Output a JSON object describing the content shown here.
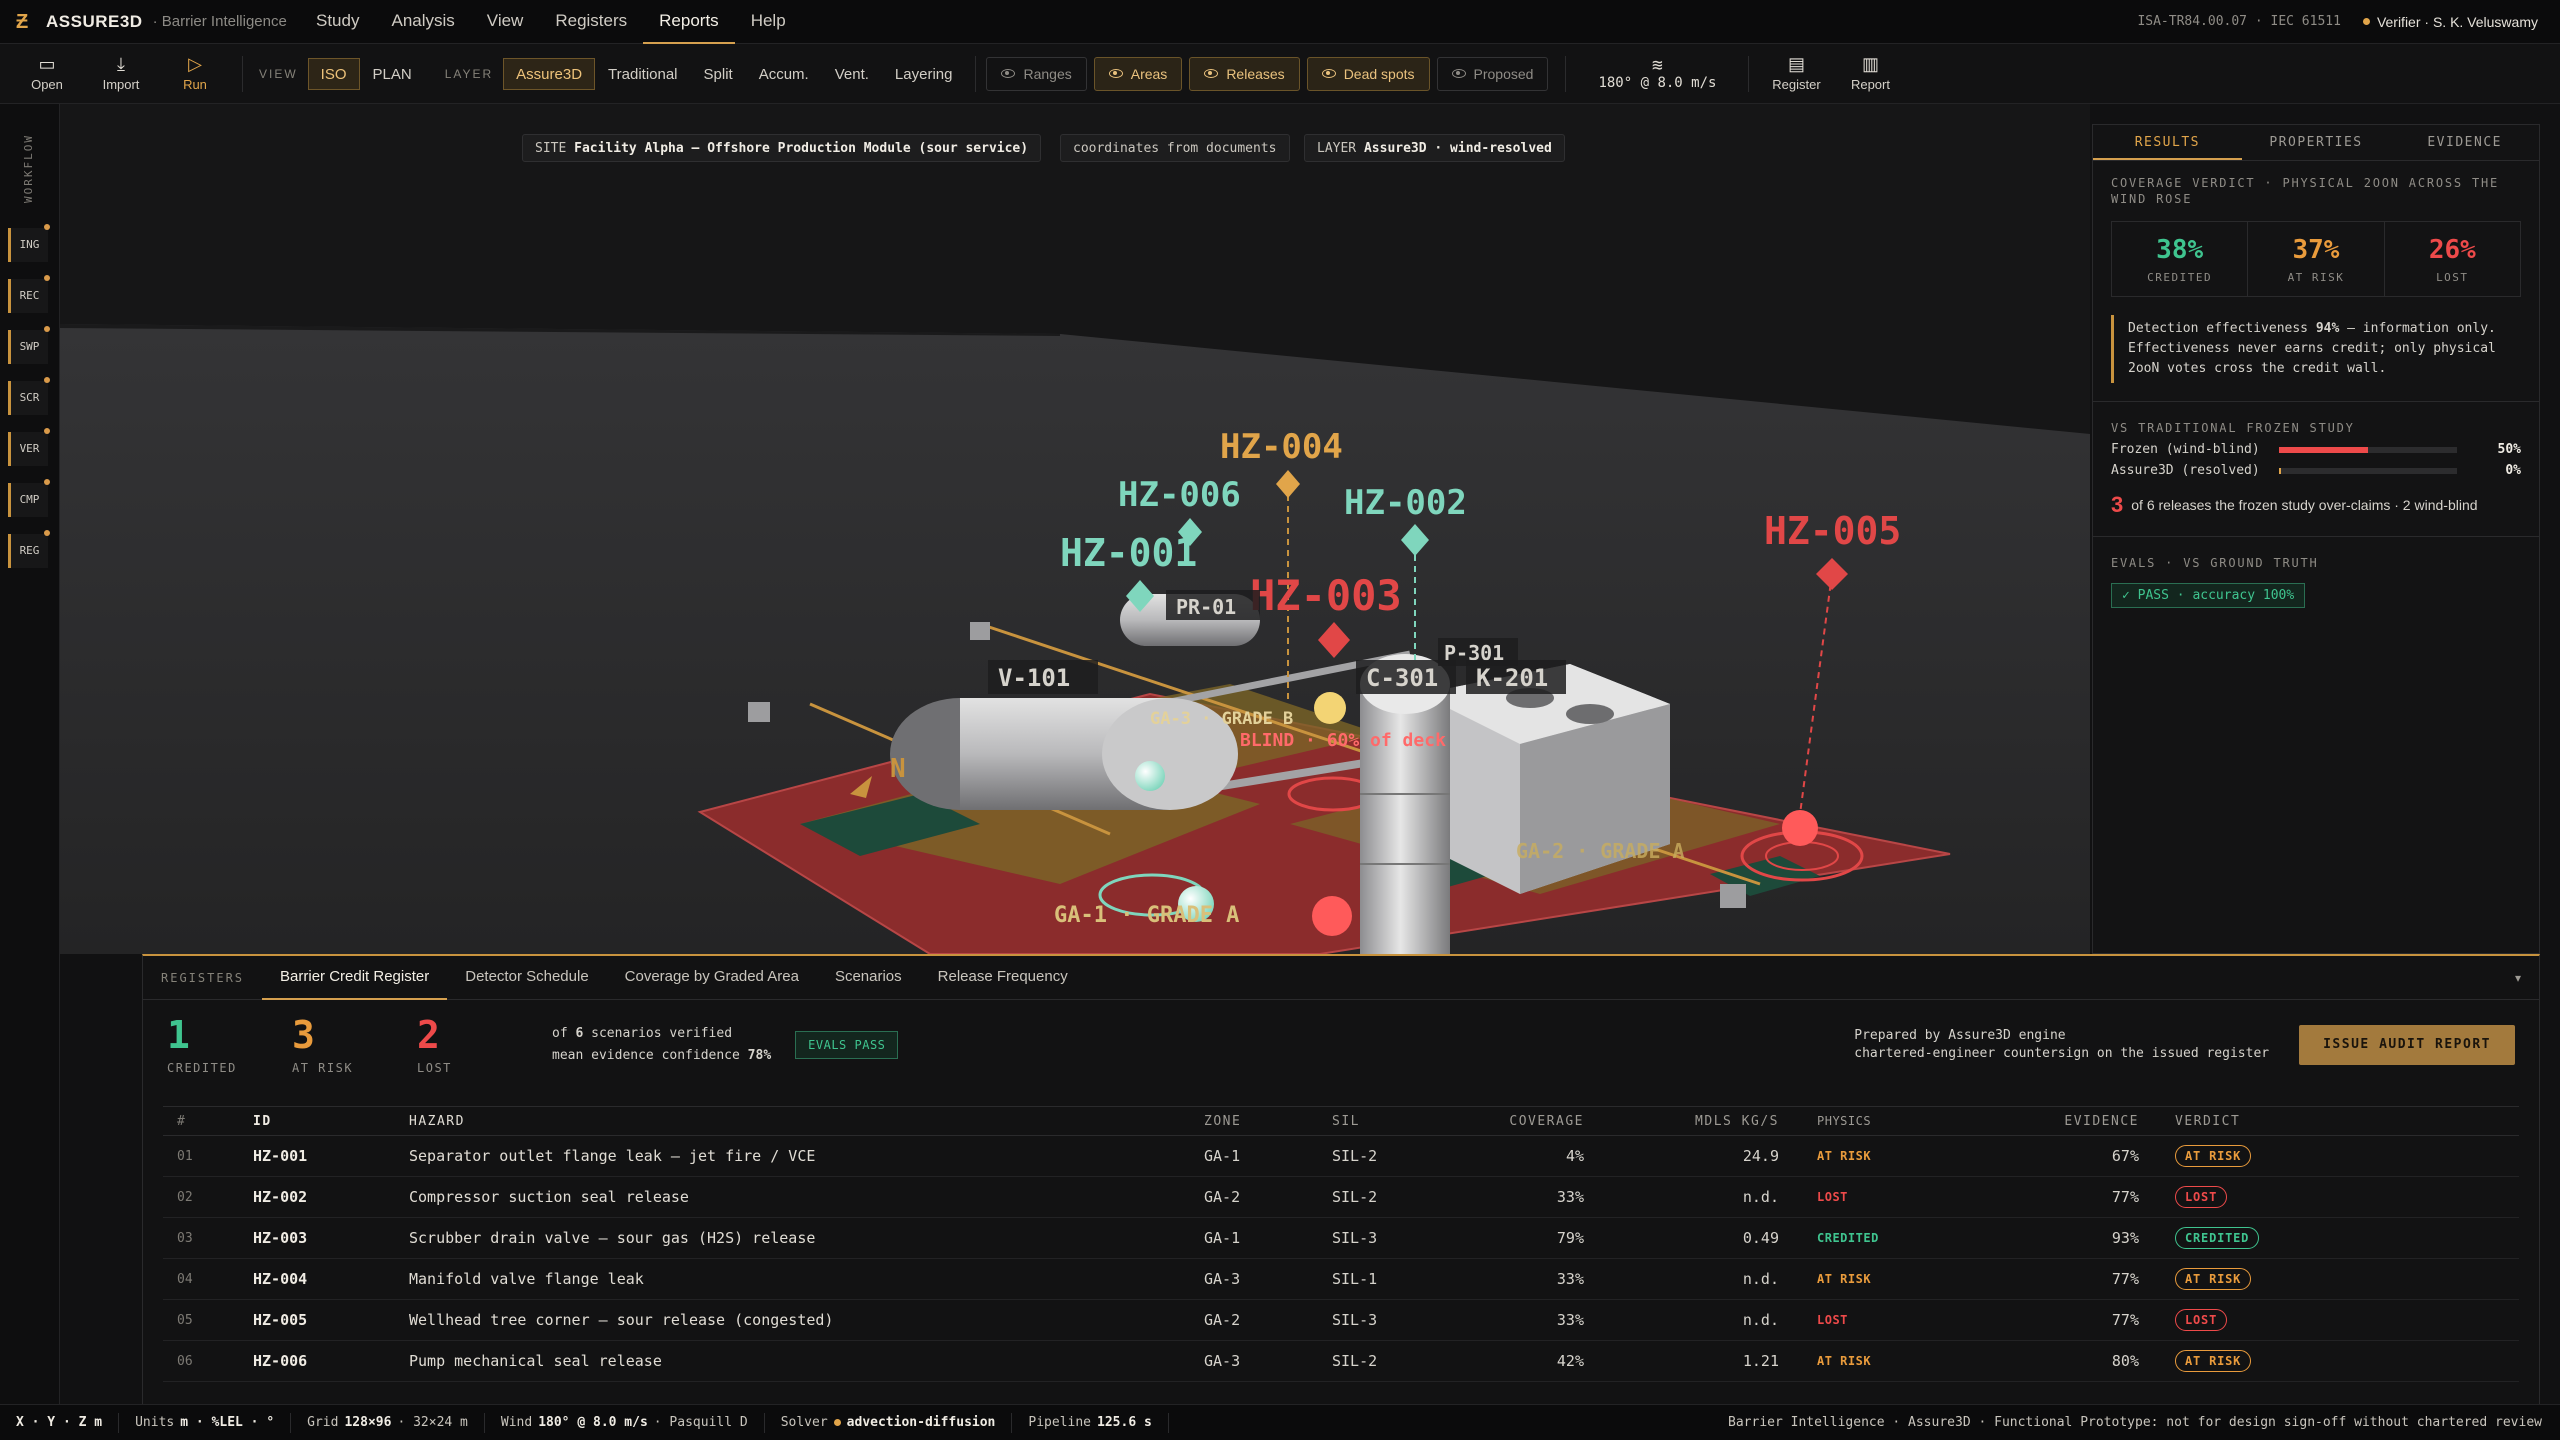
{
  "brand": {
    "name": "ASSURE3D",
    "sub": "· Barrier Intelligence"
  },
  "menu": [
    "Study",
    "Analysis",
    "View",
    "Registers",
    "Reports",
    "Help"
  ],
  "menu_active": "Reports",
  "std_ref": "ISA-TR84.00.07 · IEC 61511",
  "verifier": "Verifier · S. K. Veluswamy",
  "toolbar": {
    "file": [
      {
        "icon": "▭",
        "label": "Open"
      },
      {
        "icon": "⤓",
        "label": "Import"
      },
      {
        "icon": "▷",
        "label": "Run"
      }
    ],
    "view_label": "VIEW",
    "view_opts": [
      "ISO",
      "PLAN"
    ],
    "layer_label": "LAYER",
    "layer_opts": [
      "Assure3D",
      "Traditional",
      "Split",
      "Accum.",
      "Vent.",
      "Layering"
    ],
    "toggles": [
      {
        "label": "Ranges",
        "on": false
      },
      {
        "label": "Areas",
        "on": true
      },
      {
        "label": "Releases",
        "on": true
      },
      {
        "label": "Dead spots",
        "on": true
      },
      {
        "label": "Proposed",
        "on": false
      }
    ],
    "wind_icon": "≋",
    "wind": "180° @ 8.0 m/s",
    "docs": [
      {
        "icon": "▤",
        "label": "Register"
      },
      {
        "icon": "▥",
        "label": "Report"
      }
    ]
  },
  "workflow": {
    "title": "WORKFLOW",
    "steps": [
      "ING",
      "REC",
      "SWP",
      "SCR",
      "VER",
      "CMP",
      "REG"
    ]
  },
  "viewport": {
    "chip_site_k": "SITE",
    "chip_site_v": "Facility Alpha — Offshore Production Module (sour service)",
    "chip_coords": "coordinates from documents",
    "chip_layer_k": "LAYER",
    "chip_layer_v": "Assure3D · wind-resolved",
    "hz": {
      "hz1": "HZ-001",
      "hz2": "HZ-002",
      "hz3": "HZ-003",
      "hz4": "HZ-004",
      "hz5": "HZ-005",
      "hz6": "HZ-006"
    },
    "eq": {
      "pr01": "PR-01",
      "v101": "V-101",
      "c301": "C-301",
      "k201": "K-201",
      "p301": "P-301"
    },
    "areas": {
      "ga1": "GA-1 · GRADE A",
      "ga2": "GA-2 · GRADE A",
      "ga3": "GA-3 · GRADE B"
    },
    "blind": "BLIND · 60% of deck",
    "north": "N"
  },
  "results": {
    "tabs": [
      "RESULTS",
      "PROPERTIES",
      "EVIDENCE"
    ],
    "verdict_title": "COVERAGE VERDICT · PHYSICAL 2OON ACROSS THE WIND ROSE",
    "cards": [
      {
        "pct": "38%",
        "label": "CREDITED",
        "color": "#3fc48f"
      },
      {
        "pct": "37%",
        "label": "AT RISK",
        "color": "#e99b3c"
      },
      {
        "pct": "26%",
        "label": "LOST",
        "color": "#ee4a4a"
      }
    ],
    "detect_pre": "Detection effectiveness ",
    "detect_val": "94%",
    "detect_post": " — information only. Effectiveness never earns credit; only physical 2ooN votes cross the credit wall.",
    "cmp_title": "VS TRADITIONAL FROZEN STUDY",
    "cmp": [
      {
        "label": "Frozen (wind-blind)",
        "value": 50,
        "text": "50%",
        "color": "#ee4a4a"
      },
      {
        "label": "Assure3D (resolved)",
        "value": 1,
        "text": "0%",
        "color": "#e1a54a"
      }
    ],
    "overclaim_n": "3",
    "overclaim_t": "of 6 releases the frozen study over-claims · 2 wind-blind",
    "evals_title": "EVALS · VS GROUND TRUTH",
    "evals_pass": "✓ PASS · accuracy 100%"
  },
  "registers": {
    "label": "REGISTERS",
    "tabs": [
      "Barrier Credit Register",
      "Detector Schedule",
      "Coverage by Graded Area",
      "Scenarios",
      "Release Frequency"
    ],
    "collapse": "▾",
    "summary": [
      {
        "n": "1",
        "label": "CREDITED",
        "color": "#3fc48f"
      },
      {
        "n": "3",
        "label": "AT RISK",
        "color": "#e99b3c"
      },
      {
        "n": "2",
        "label": "LOST",
        "color": "#ee4a4a"
      }
    ],
    "note1_pre": "of ",
    "note1_b": "6",
    "note1_post": " scenarios verified",
    "note2_pre": "mean evidence confidence ",
    "note2_b": "78%",
    "evals_badge": "EVALS PASS",
    "prep1": "Prepared by Assure3D engine",
    "prep2": "chartered-engineer countersign on the issued register",
    "issue": "ISSUE AUDIT REPORT",
    "columns": [
      "#",
      "ID",
      "HAZARD",
      "ZONE",
      "SIL",
      "COVERAGE",
      "MDLS KG/S",
      "PHYSICS",
      "EVIDENCE",
      "VERDICT"
    ],
    "rows": [
      {
        "n": "01",
        "id": "HZ-001",
        "hazard": "Separator outlet flange leak — jet fire / VCE",
        "zone": "GA-1",
        "sil": "SIL-2",
        "cov": "4%",
        "mdl": "24.9",
        "phys": "AT RISK",
        "ev": "67%",
        "verdict": "AT RISK",
        "tone": "amber"
      },
      {
        "n": "02",
        "id": "HZ-002",
        "hazard": "Compressor suction seal release",
        "zone": "GA-2",
        "sil": "SIL-2",
        "cov": "33%",
        "mdl": "n.d.",
        "phys": "LOST",
        "ev": "77%",
        "verdict": "LOST",
        "tone": "red"
      },
      {
        "n": "03",
        "id": "HZ-003",
        "hazard": "Scrubber drain valve — sour gas (H2S) release",
        "zone": "GA-1",
        "sil": "SIL-3",
        "cov": "79%",
        "mdl": "0.49",
        "phys": "CREDITED",
        "ev": "93%",
        "verdict": "CREDITED",
        "tone": "green"
      },
      {
        "n": "04",
        "id": "HZ-004",
        "hazard": "Manifold valve flange leak",
        "zone": "GA-3",
        "sil": "SIL-1",
        "cov": "33%",
        "mdl": "n.d.",
        "phys": "AT RISK",
        "ev": "77%",
        "verdict": "AT RISK",
        "tone": "amber"
      },
      {
        "n": "05",
        "id": "HZ-005",
        "hazard": "Wellhead tree corner — sour release (congested)",
        "zone": "GA-2",
        "sil": "SIL-3",
        "cov": "33%",
        "mdl": "n.d.",
        "phys": "LOST",
        "ev": "77%",
        "verdict": "LOST",
        "tone": "red"
      },
      {
        "n": "06",
        "id": "HZ-006",
        "hazard": "Pump mechanical seal release",
        "zone": "GA-3",
        "sil": "SIL-2",
        "cov": "42%",
        "mdl": "1.21",
        "phys": "AT RISK",
        "ev": "80%",
        "verdict": "AT RISK",
        "tone": "amber"
      }
    ]
  },
  "status": {
    "coords": "X · Y · Z m",
    "units_k": "Units",
    "units_v": "m · %LEL · °",
    "grid_k": "Grid",
    "grid_v": "128×96",
    "grid_extra": "· 32×24 m",
    "wind_k": "Wind",
    "wind_v": "180° @ 8.0 m/s",
    "wind_extra": "· Pasquill D",
    "solver_k": "Solver",
    "solver_v": "advection-diffusion",
    "pipe_k": "Pipeline",
    "pipe_v": "125.6 s",
    "right": "Barrier Intelligence · Assure3D · Functional Prototype: not for design sign-off without chartered review"
  }
}
